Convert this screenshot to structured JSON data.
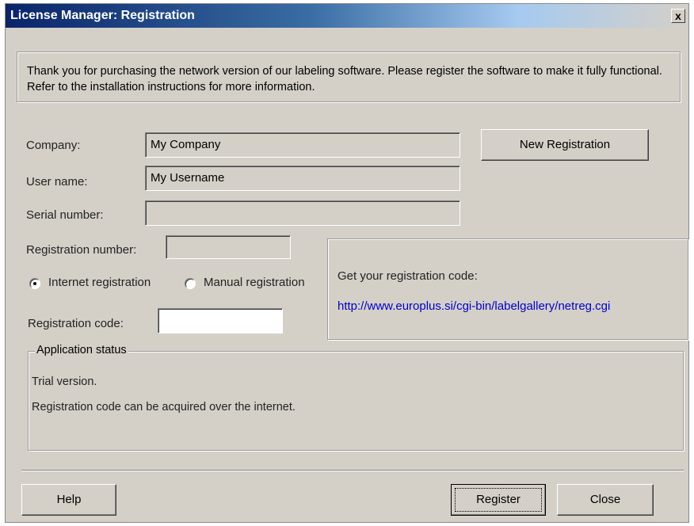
{
  "window": {
    "title": "License Manager: Registration",
    "close_glyph": "x"
  },
  "intro": {
    "text": "Thank you for purchasing the network version of our labeling software. Please register the software to make it fully functional. Refer to the installation instructions for more information."
  },
  "form": {
    "company_label": "Company:",
    "company_value": "My Company",
    "username_label": "User name:",
    "username_value": "My Username",
    "serial_label": "Serial number:",
    "serial_value": "",
    "regnum_label": "Registration number:",
    "regnum_value": "",
    "internet_label": "Internet registration",
    "manual_label": "Manual registration",
    "selected_mode": "internet",
    "regcode_label": "Registration code:",
    "regcode_value": ""
  },
  "buttons": {
    "new_registration": "New Registration",
    "help": "Help",
    "register": "Register",
    "close": "Close"
  },
  "info": {
    "heading": "Get your registration code:",
    "url": "http://www.europlus.si/cgi-bin/labelgallery/netreg.cgi"
  },
  "status": {
    "title": "Application status",
    "line1": "Trial version.",
    "line2": "Registration code can be acquired over the internet."
  }
}
